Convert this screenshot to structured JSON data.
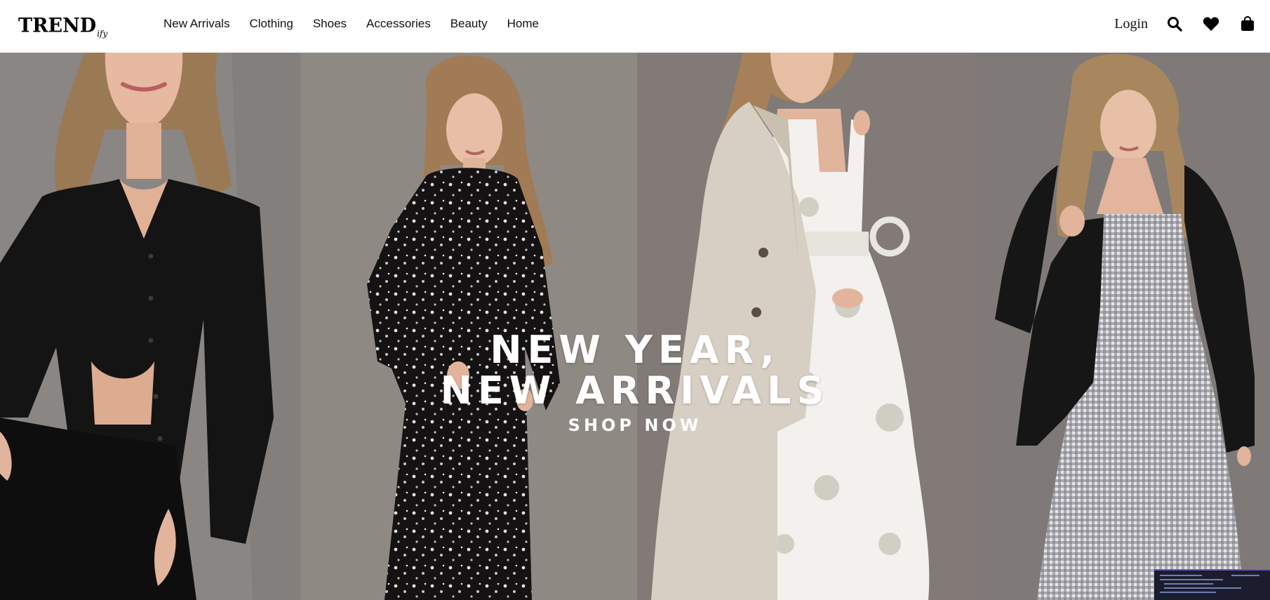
{
  "brand": {
    "main": "TREND",
    "sub": "ify"
  },
  "nav": {
    "items": [
      "New Arrivals",
      "Clothing",
      "Shoes",
      "Accessories",
      "Beauty",
      "Home"
    ]
  },
  "header_actions": {
    "login_label": "Login",
    "icons": [
      "search-icon",
      "heart-icon",
      "shopping-bag-icon"
    ]
  },
  "hero": {
    "headline_line1": "NEW YEAR,",
    "headline_line2": "NEW ARRIVALS",
    "cta_label": "SHOP NOW",
    "panels": [
      "model-black-cardigan-skirt",
      "model-floral-black-dress",
      "model-white-floral-dress-trench-coat",
      "model-gingham-dress-black-cardigan"
    ]
  },
  "colors": {
    "header_bg": "#ffffff",
    "text": "#111111",
    "hero_text": "#ffffff"
  }
}
